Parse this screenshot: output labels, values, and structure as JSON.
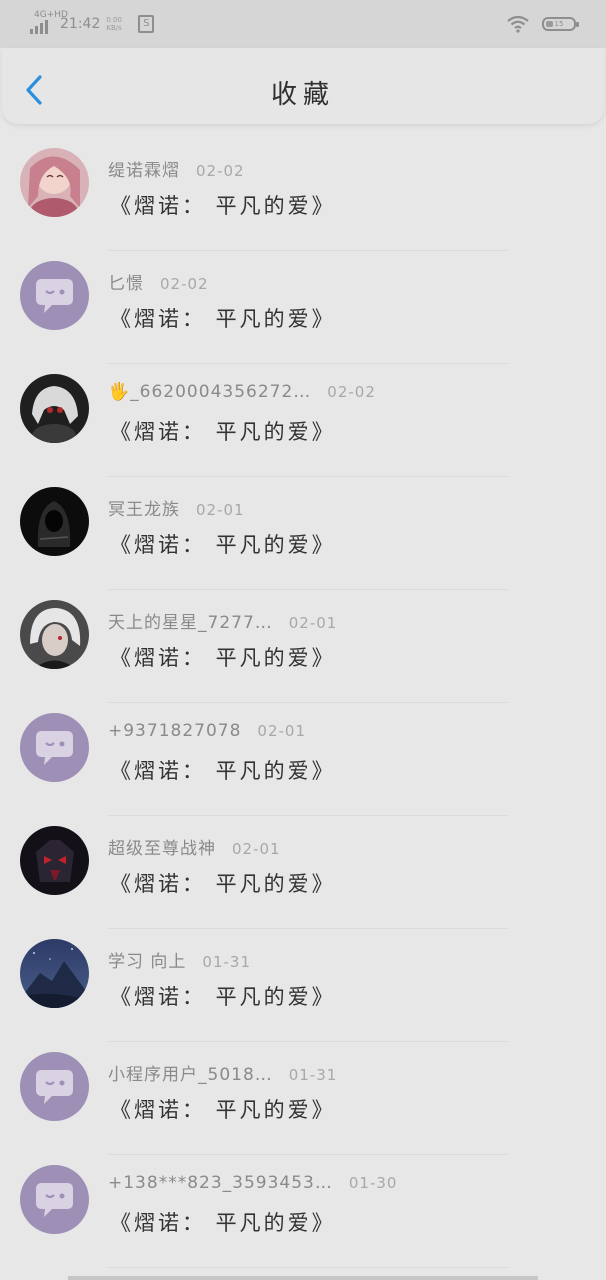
{
  "status_bar": {
    "network": "4G+HD",
    "carrier_time": "21:42",
    "speed_value": "0.00",
    "speed_unit": "KB/s",
    "battery_percent": "15"
  },
  "header": {
    "title": "收藏",
    "back_icon": "chevron-left-icon"
  },
  "favorites": [
    {
      "name": "缇诺霖熠",
      "date": "02-02",
      "subtitle": "《熠诺： 平凡的爱》",
      "avatar": "anime-girl-pink"
    },
    {
      "name": "匕憬",
      "date": "02-02",
      "subtitle": "《熠诺： 平凡的爱》",
      "avatar": "default-chat"
    },
    {
      "name": "🖐_6620004356272…",
      "date": "02-02",
      "subtitle": "《熠诺： 平凡的爱》",
      "avatar": "white-hair-dark"
    },
    {
      "name": "冥王龙族",
      "date": "02-01",
      "subtitle": "《熠诺： 平凡的爱》",
      "avatar": "dark-hood"
    },
    {
      "name": "天上的星星_7277…",
      "date": "02-01",
      "subtitle": "《熠诺： 平凡的爱》",
      "avatar": "white-hair-boy"
    },
    {
      "name": "+9371827078",
      "date": "02-01",
      "subtitle": "《熠诺： 平凡的爱》",
      "avatar": "default-chat"
    },
    {
      "name": "超级至尊战神",
      "date": "02-01",
      "subtitle": "《熠诺： 平凡的爱》",
      "avatar": "robot-red"
    },
    {
      "name": "学习 向上",
      "date": "01-31",
      "subtitle": "《熠诺： 平凡的爱》",
      "avatar": "night-mountain"
    },
    {
      "name": "小程序用户_5018…",
      "date": "01-31",
      "subtitle": "《熠诺： 平凡的爱》",
      "avatar": "default-chat"
    },
    {
      "name": "+138***823_3593453…",
      "date": "01-30",
      "subtitle": "《熠诺： 平凡的爱》",
      "avatar": "default-chat"
    }
  ],
  "colors": {
    "default_avatar_bg": "#9d8fb6",
    "accent_blue": "#2b8fe0"
  }
}
